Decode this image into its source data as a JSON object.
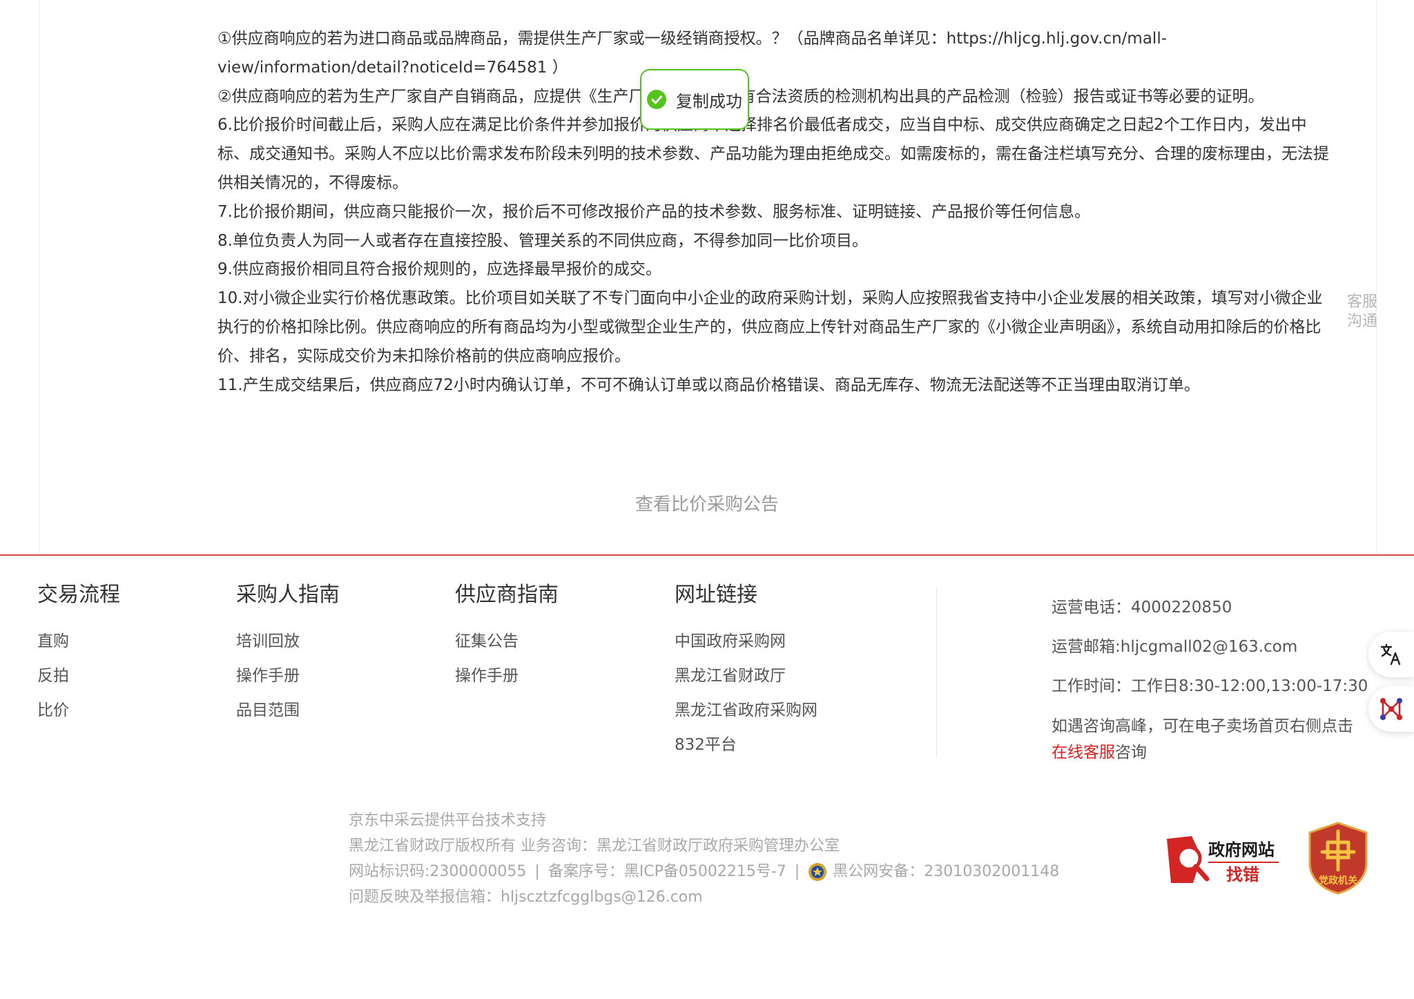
{
  "rules": {
    "p1": "①供应商响应的若为进口商品或品牌商品，需提供生产厂家或一级经销商授权。？（品牌商品名单详见：https://hljcg.hlj.gov.cn/mall-view/information/detail?noticeId=764581 ）",
    "p2": "②供应商响应的若为生产厂家自产自销商品，应提供《生产厂家证明》和具有合法资质的检测机构出具的产品检测（检验）报告或证书等必要的证明。",
    "p3": "6.比价报价时间截止后，采购人应在满足比价条件并参加报价的供应商中选择排名价最低者成交，应当自中标、成交供应商确定之日起2个工作日内，发出中标、成交通知书。采购人不应以比价需求发布阶段未列明的技术参数、产品功能为理由拒绝成交。如需废标的，需在备注栏填写充分、合理的废标理由，无法提供相关情况的，不得废标。",
    "p4": "7.比价报价期间，供应商只能报价一次，报价后不可修改报价产品的技术参数、服务标准、证明链接、产品报价等任何信息。",
    "p5": "8.单位负责人为同一人或者存在直接控股、管理关系的不同供应商，不得参加同一比价项目。",
    "p6": "9.供应商报价相同且符合报价规则的，应选择最早报价的成交。",
    "p7": "10.对小微企业实行价格优惠政策。比价项目如关联了不专门面向中小企业的政府采购计划，采购人应按照我省支持中小企业发展的相关政策，填写对小微企业执行的价格扣除比例。供应商响应的所有商品均为小型或微型企业生产的，供应商应上传针对商品生产厂家的《小微企业声明函》，系统自动用扣除后的价格比价、排名，实际成交价为未扣除价格前的供应商响应报价。",
    "p8": "11.产生成交结果后，供应商应72小时内确认订单，不可不确认订单或以商品价格错误、商品无库存、物流无法配送等不正当理由取消订单。"
  },
  "view_notice_link": "查看比价采购公告",
  "toast": {
    "text": "复制成功",
    "color": "#52c41a"
  },
  "side_service": {
    "line1": "客服",
    "line2": "沟通"
  },
  "footer": {
    "columns": [
      {
        "title": "交易流程",
        "items": [
          "直购",
          "反拍",
          "比价"
        ]
      },
      {
        "title": "采购人指南",
        "items": [
          "培训回放",
          "操作手册",
          "品目范围"
        ]
      },
      {
        "title": "供应商指南",
        "items": [
          "征集公告",
          "操作手册"
        ]
      },
      {
        "title": "网址链接",
        "items": [
          "中国政府采购网",
          "黑龙江省财政厅",
          "黑龙江省政府采购网",
          "832平台"
        ]
      }
    ],
    "contact": {
      "phone": "运营电话：4000220850",
      "email": "运营邮箱:hljcgmall02@163.com",
      "hours": "工作时间：工作日8:30-12:00,13:00-17:30",
      "consult_prefix": "如遇咨询高峰，可在电子卖场首页右侧点击",
      "consult_link": "在线客服",
      "consult_suffix": "咨询"
    }
  },
  "bottom": {
    "tech_support": "京东中采云提供平台技术支持",
    "copyright": "黑龙江省财政厅版权所有 业务咨询：黑龙江省财政厅政府采购管理办公室",
    "site_id": "网站标识码:2300000055",
    "icp": "备案序号：黑ICP备05002215号-7",
    "police": "黑公网安备：23010302001148",
    "report": "问题反映及举报信箱：hljscztzfcgglbgs@126.com",
    "sep": "|"
  },
  "badges": {
    "zfwz_line1": "政府网站",
    "zfwz_line2": "找错",
    "dzjg_text": "党政机关"
  },
  "colors": {
    "accent_red": "#e02020",
    "divider_red": "#e04848",
    "muted_text": "#a8a8a8"
  }
}
